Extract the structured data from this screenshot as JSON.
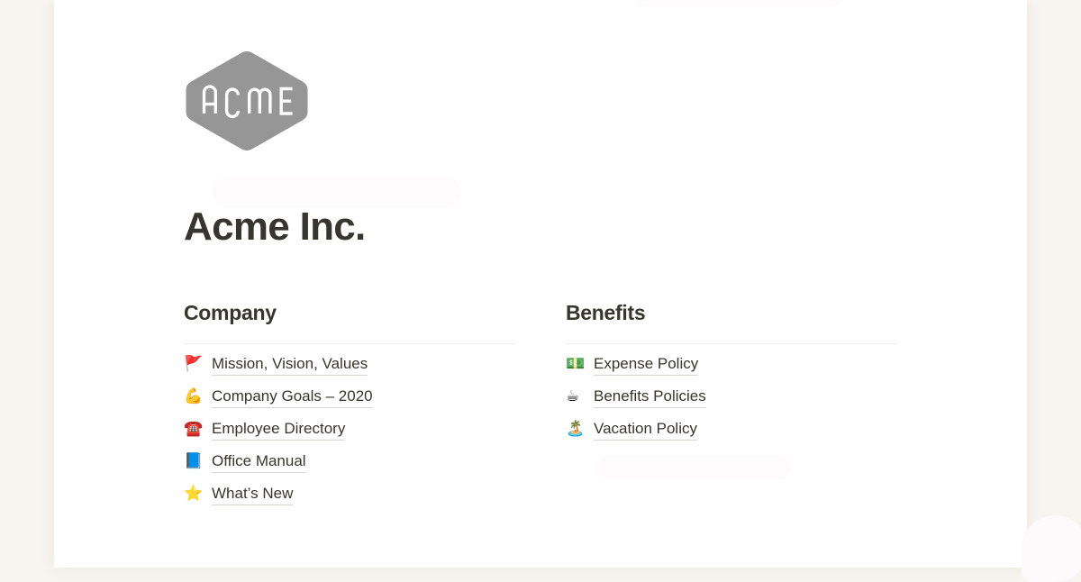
{
  "page": {
    "title": "Acme Inc.",
    "background_color": "#f7f5f0",
    "sheet_color": "#ffffff",
    "text_color": "#37352f"
  },
  "logo": {
    "label": "ACME",
    "shape": "hexagon",
    "fill_color": "#969696",
    "text_color": "#ffffff"
  },
  "columns": [
    {
      "heading": "Company",
      "links": [
        {
          "emoji": "🚩",
          "icon_name": "triangular-flag-emoji",
          "label": "Mission, Vision, Values"
        },
        {
          "emoji": "💪",
          "icon_name": "flexed-biceps-emoji",
          "label": "Company Goals – 2020"
        },
        {
          "emoji": "☎️",
          "icon_name": "telephone-emoji",
          "label": "Employee Directory"
        },
        {
          "emoji": "📘",
          "icon_name": "blue-book-emoji",
          "label": "Office Manual"
        },
        {
          "emoji": "⭐",
          "icon_name": "star-emoji",
          "label": "What’s New"
        }
      ]
    },
    {
      "heading": "Benefits",
      "links": [
        {
          "emoji": "💵",
          "icon_name": "dollar-banknote-emoji",
          "label": "Expense Policy"
        },
        {
          "emoji": "☕",
          "icon_name": "hot-beverage-emoji",
          "label": "Benefits Policies"
        },
        {
          "emoji": "🏝️",
          "icon_name": "desert-island-emoji",
          "label": "Vacation Policy"
        }
      ]
    }
  ]
}
